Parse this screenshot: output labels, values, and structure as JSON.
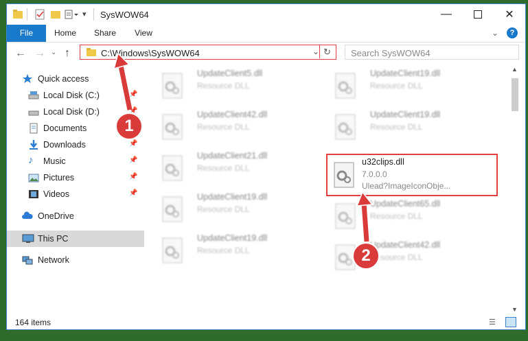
{
  "window": {
    "title": "SysWOW64"
  },
  "ribbon": {
    "tabs": [
      "File",
      "Home",
      "Share",
      "View"
    ]
  },
  "address": {
    "path": "C:\\Windows\\SysWOW64"
  },
  "search": {
    "placeholder": "Search SysWOW64"
  },
  "nav": {
    "quick_access": "Quick access",
    "items": [
      "Local Disk (C:)",
      "Local Disk (D:)",
      "Documents",
      "Downloads",
      "Music",
      "Pictures",
      "Videos"
    ],
    "onedrive": "OneDrive",
    "this_pc": "This PC",
    "network": "Network"
  },
  "files": [
    {
      "name": "UpdateClient5.dll",
      "type": "Resource DLL"
    },
    {
      "name": "UpdateClient19.dll",
      "type": "Resource DLL"
    },
    {
      "name": "UpdateClient42.dll",
      "type": "Resource DLL"
    },
    {
      "name": "UpdateClient19.dll",
      "type": "Resource DLL"
    },
    {
      "name": "UpdateClient21.dll",
      "type": "Resource DLL"
    },
    {
      "name": "u32clips.dll",
      "version": "7.0.0.0",
      "desc": "Ulead?ImageIconObje..."
    },
    {
      "name": "UpdateClient19.dll",
      "type": "Resource DLL"
    },
    {
      "name": "UpdateClient65.dll",
      "type": "Resource DLL"
    },
    {
      "name": "UpdateClient19.dll",
      "type": "Resource DLL"
    },
    {
      "name": "UpdateClient42.dll",
      "type": "Resource DLL"
    }
  ],
  "status": {
    "count": "164 items"
  },
  "callouts": [
    "1",
    "2"
  ],
  "colors": {
    "accent": "#1979ca",
    "highlight": "#e43d3d",
    "callout": "#d93a3a"
  }
}
